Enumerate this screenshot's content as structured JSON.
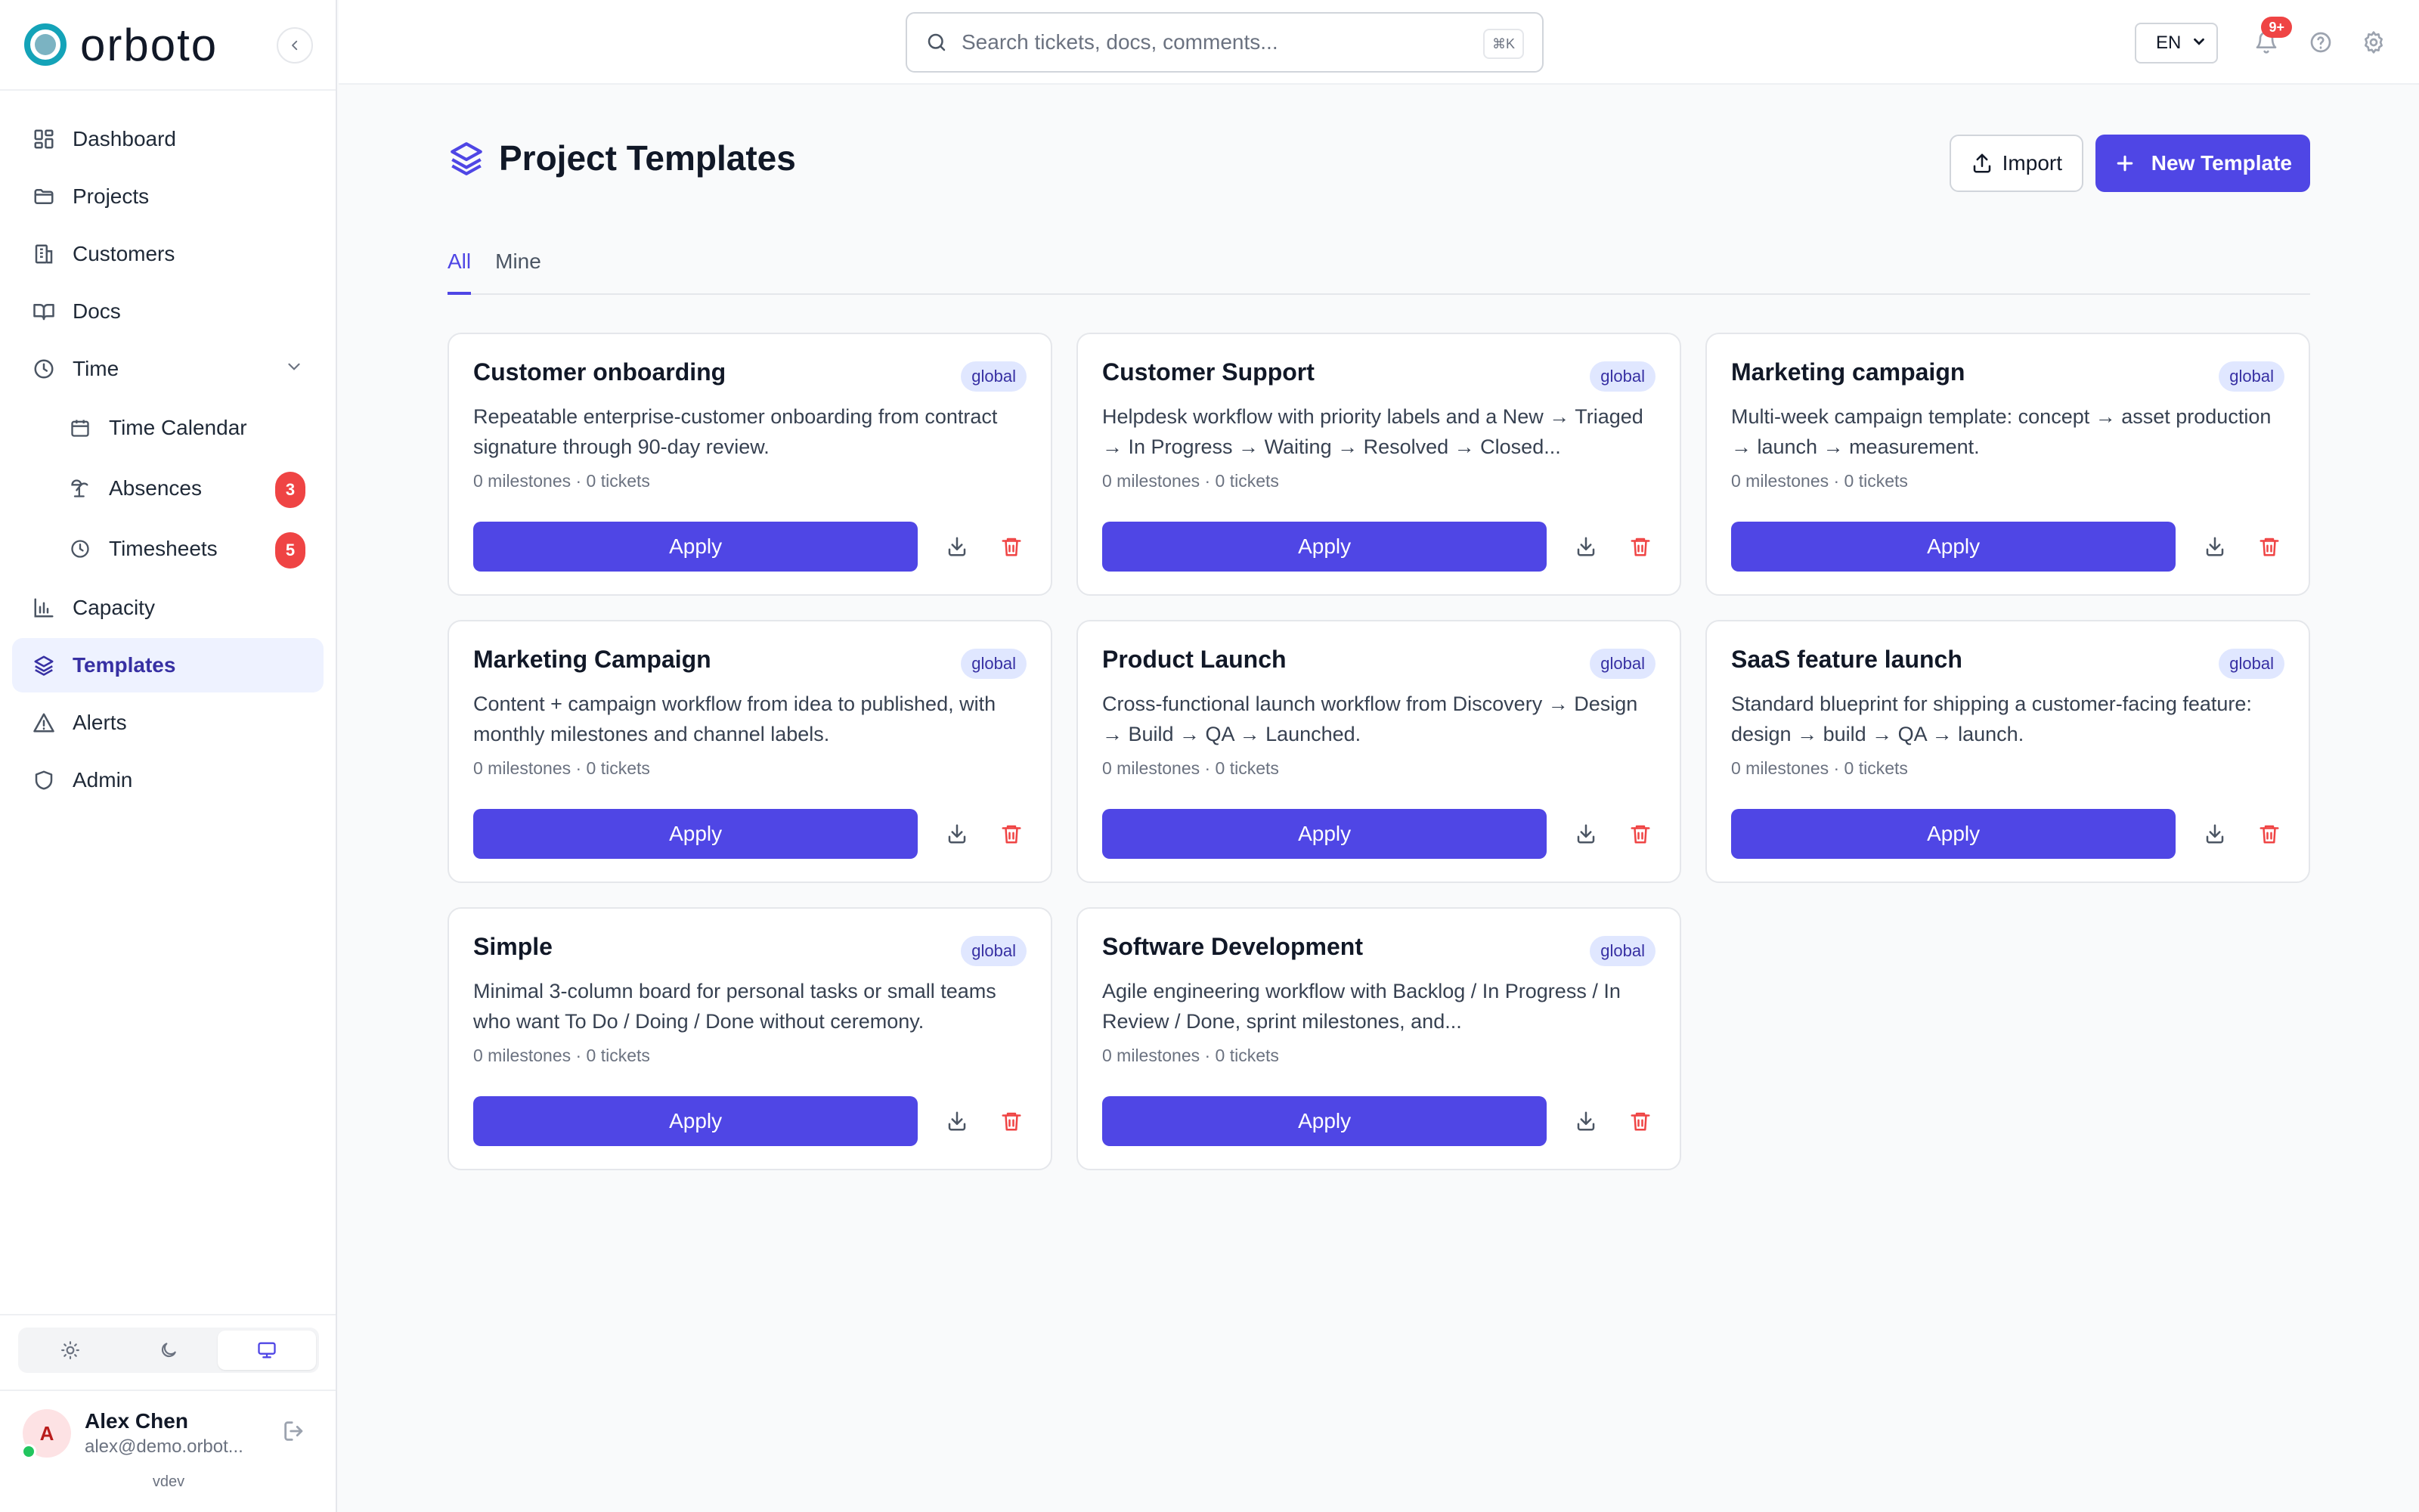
{
  "brand": {
    "name": "orboto"
  },
  "sidebar": {
    "items": [
      {
        "label": "Dashboard",
        "icon": "grid-icon"
      },
      {
        "label": "Projects",
        "icon": "folder-icon"
      },
      {
        "label": "Customers",
        "icon": "building-icon"
      },
      {
        "label": "Docs",
        "icon": "book-icon"
      },
      {
        "label": "Time",
        "icon": "clock-icon"
      },
      {
        "label": "Time Calendar",
        "icon": "calendar-icon"
      },
      {
        "label": "Absences",
        "icon": "palm-tree-icon",
        "badge": "3"
      },
      {
        "label": "Timesheets",
        "icon": "clock-icon",
        "badge": "5"
      },
      {
        "label": "Capacity",
        "icon": "bar-chart-icon"
      },
      {
        "label": "Templates",
        "icon": "layers-icon"
      },
      {
        "label": "Alerts",
        "icon": "alert-triangle-icon"
      },
      {
        "label": "Admin",
        "icon": "shield-icon"
      }
    ],
    "active": "Templates",
    "theme": {
      "selected": "system"
    },
    "user": {
      "initial": "A",
      "name": "Alex Chen",
      "email": "alex@demo.orbot..."
    },
    "version": "vdev"
  },
  "topbar": {
    "search_placeholder": "Search tickets, docs, comments...",
    "shortcut": "⌘K",
    "language": "EN",
    "notification_count": "9+"
  },
  "page": {
    "title": "Project Templates",
    "import_label": "Import",
    "new_label": "New Template",
    "tabs": [
      {
        "label": "All"
      },
      {
        "label": "Mine"
      }
    ],
    "active_tab": "All"
  },
  "templates": [
    {
      "title": "Customer onboarding",
      "scope": "global",
      "description": "Repeatable enterprise-customer onboarding from contract signature through 90-day review.",
      "meta": "0 milestones · 0 tickets",
      "apply_label": "Apply"
    },
    {
      "title": "Customer Support",
      "scope": "global",
      "description": "Helpdesk workflow with priority labels and a New → Triaged → In Progress → Waiting → Resolved → Closed...",
      "meta": "0 milestones · 0 tickets",
      "apply_label": "Apply"
    },
    {
      "title": "Marketing campaign",
      "scope": "global",
      "description": "Multi-week campaign template: concept → asset production → launch → measurement.",
      "meta": "0 milestones · 0 tickets",
      "apply_label": "Apply"
    },
    {
      "title": "Marketing Campaign",
      "scope": "global",
      "description": "Content + campaign workflow from idea to published, with monthly milestones and channel labels.",
      "meta": "0 milestones · 0 tickets",
      "apply_label": "Apply"
    },
    {
      "title": "Product Launch",
      "scope": "global",
      "description": "Cross-functional launch workflow from Discovery → Design → Build → QA → Launched.",
      "meta": "0 milestones · 0 tickets",
      "apply_label": "Apply"
    },
    {
      "title": "SaaS feature launch",
      "scope": "global",
      "description": "Standard blueprint for shipping a customer-facing feature: design → build → QA → launch.",
      "meta": "0 milestones · 0 tickets",
      "apply_label": "Apply"
    },
    {
      "title": "Simple",
      "scope": "global",
      "description": "Minimal 3-column board for personal tasks or small teams who want To Do / Doing / Done without ceremony.",
      "meta": "0 milestones · 0 tickets",
      "apply_label": "Apply"
    },
    {
      "title": "Software Development",
      "scope": "global",
      "description": "Agile engineering workflow with Backlog / In Progress / In Review / Done, sprint milestones, and...",
      "meta": "0 milestones · 0 tickets",
      "apply_label": "Apply"
    }
  ],
  "colors": {
    "accent": "#4f46e5",
    "danger": "#ef4444",
    "brand": "#14a3b8"
  }
}
